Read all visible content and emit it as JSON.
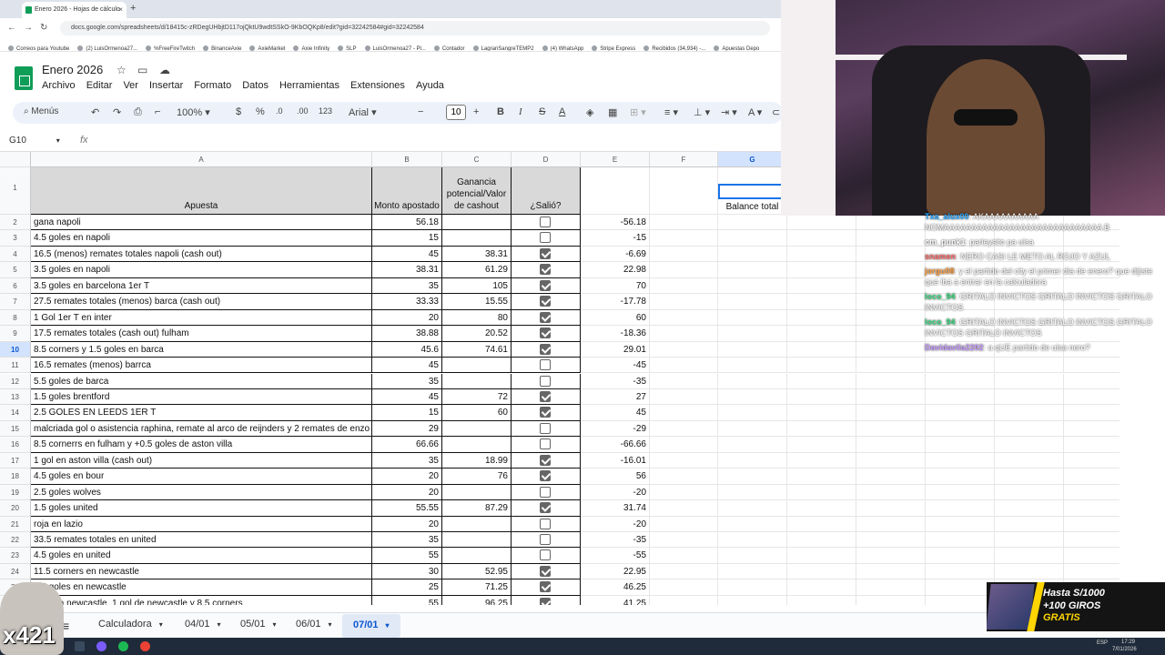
{
  "browser": {
    "tab_title": "Enero 2026 - Hojas de cálculo",
    "new_tab": "+",
    "url": "docs.google.com/spreadsheets/d/18415c-zRDegUHbjtD117ojQktU9wdtSSkO-9KbOQKp8/edit?gid=32242584#gid=32242584",
    "bookmarks": [
      "Correos para Youtube",
      "(2) LuisOrmenoa27...",
      "%FreeFireTwitch",
      "BinanceAxie",
      "AxieMarket",
      "Axie Infinity",
      "SLP",
      "LuisOrmenoa27 - Pl...",
      "Contador",
      "LagranSangreTEMP2",
      "(4) WhatsApp",
      "Stripe Express",
      "Recibidos (34,934) -...",
      "Apuestas Depo"
    ]
  },
  "sheets": {
    "doc_title": "Enero 2026",
    "menu": [
      "Archivo",
      "Editar",
      "Ver",
      "Insertar",
      "Formato",
      "Datos",
      "Herramientas",
      "Extensiones",
      "Ayuda"
    ],
    "toolbar": {
      "search": "Menús",
      "zoom": "100%",
      "currency": "$",
      "percent": "%",
      "dec_less": ".0",
      "dec_more": ".00",
      "format_123": "123",
      "font": "Arial",
      "font_size": "10",
      "bold": "B",
      "italic": "I"
    },
    "name_box": "G10",
    "fx": "fx",
    "col_headers": [
      "A",
      "B",
      "C",
      "D",
      "E",
      "F",
      "G"
    ],
    "headers": {
      "apuesta": "Apuesta",
      "monto": "Monto apostado",
      "ganancia": "Ganancia potencial/Valor de cashout",
      "salio": "¿Salió?",
      "balance": "Balance total"
    },
    "rows": [
      {
        "n": "2",
        "a": "gana napoli",
        "b": "56.18",
        "c": "",
        "d": false,
        "e": "-56.18"
      },
      {
        "n": "3",
        "a": "4.5 goles en napoli",
        "b": "15",
        "c": "",
        "d": false,
        "e": "-15"
      },
      {
        "n": "4",
        "a": "16.5 (menos) remates totales napoli (cash out)",
        "b": "45",
        "c": "38.31",
        "d": true,
        "e": "-6.69"
      },
      {
        "n": "5",
        "a": "3.5 goles en napoli",
        "b": "38.31",
        "c": "61.29",
        "d": true,
        "e": "22.98"
      },
      {
        "n": "6",
        "a": "3.5 goles en barcelona 1er T",
        "b": "35",
        "c": "105",
        "d": true,
        "e": "70"
      },
      {
        "n": "7",
        "a": "27.5 remates totales (menos) barca (cash out)",
        "b": "33.33",
        "c": "15.55",
        "d": true,
        "e": "-17.78"
      },
      {
        "n": "8",
        "a": "1 Gol 1er T en inter",
        "b": "20",
        "c": "80",
        "d": true,
        "e": "60"
      },
      {
        "n": "9",
        "a": "17.5 remates totales (cash out) fulham",
        "b": "38.88",
        "c": "20.52",
        "d": true,
        "e": "-18.36"
      },
      {
        "n": "10",
        "a": "8.5 corners y 1.5 goles en barca",
        "b": "45.6",
        "c": "74.61",
        "d": true,
        "e": "29.01"
      },
      {
        "n": "11",
        "a": "16.5 remates (menos) barrca",
        "b": "45",
        "c": "",
        "d": false,
        "e": "-45"
      },
      {
        "n": "12",
        "a": "5.5 goles de barca",
        "b": "35",
        "c": "",
        "d": false,
        "e": "-35"
      },
      {
        "n": "13",
        "a": "1.5 goles brentford",
        "b": "45",
        "c": "72",
        "d": true,
        "e": "27"
      },
      {
        "n": "14",
        "a": "2.5 GOLES EN LEEDS 1ER T",
        "b": "15",
        "c": "60",
        "d": true,
        "e": "45"
      },
      {
        "n": "15",
        "a": "malcriada gol o asistencia raphina, remate al arco de reijnders y 2 remates de enzo",
        "b": "29",
        "c": "",
        "d": false,
        "e": "-29"
      },
      {
        "n": "16",
        "a": "8.5 cornerrs en fulham y +0.5 goles de aston villa",
        "b": "66.66",
        "c": "",
        "d": false,
        "e": "-66.66"
      },
      {
        "n": "17",
        "a": "1 gol en aston villa (cash out)",
        "b": "35",
        "c": "18.99",
        "d": true,
        "e": "-16.01"
      },
      {
        "n": "18",
        "a": "4.5 goles en bour",
        "b": "20",
        "c": "76",
        "d": true,
        "e": "56"
      },
      {
        "n": "19",
        "a": "2.5 goles wolves",
        "b": "20",
        "c": "",
        "d": false,
        "e": "-20"
      },
      {
        "n": "20",
        "a": "1.5 goles united",
        "b": "55.55",
        "c": "87.29",
        "d": true,
        "e": "31.74"
      },
      {
        "n": "21",
        "a": "roja en lazio",
        "b": "20",
        "c": "",
        "d": false,
        "e": "-20"
      },
      {
        "n": "22",
        "a": "33.5 remates totales en united",
        "b": "35",
        "c": "",
        "d": false,
        "e": "-35"
      },
      {
        "n": "23",
        "a": "4.5 goles en united",
        "b": "55",
        "c": "",
        "d": false,
        "e": "-55"
      },
      {
        "n": "24",
        "a": "11.5 corners en newcastle",
        "b": "30",
        "c": "52.95",
        "d": true,
        "e": "22.95"
      },
      {
        "n": "25",
        "a": "6.5 goles en newcastle",
        "b": "25",
        "c": "71.25",
        "d": true,
        "e": "46.25"
      },
      {
        "n": "26",
        "a": "empata newcastle, 1 gol de newcastle y 8.5 corners",
        "b": "55",
        "c": "96.25",
        "d": true,
        "e": "41.25"
      }
    ],
    "sheet_tabs": [
      "Calculadora",
      "04/01",
      "05/01",
      "06/01",
      "07/01"
    ],
    "active_tab": "07/01",
    "add_sheet": "+",
    "all_sheets": "≡"
  },
  "stream": {
    "chat": [
      {
        "user": "Txa_alux00",
        "color": "#2aa7ff",
        "msg": ": AKAAAAAAAAAA NOMAAAAAAAAAAAAAAAAAAAAAAAAAAAAA B"
      },
      {
        "user": "cm_punk1",
        "color": "#ffffff",
        "msg": ": parleysito pa ulsa"
      },
      {
        "user": "snamen",
        "color": "#ff6b6b",
        "msg": ": NERO CASI LE METO AL ROJO Y AZUL"
      },
      {
        "user": "jorgu08",
        "color": "#ff9e3d",
        "msg": ": y el partido del city el primer dia de enero? que dijiste que iba a entrar en la calculadora"
      },
      {
        "user": "loco_94",
        "color": "#3ddc84",
        "msg": ": GRITALO INVICTOS GRITALO INVICTOS GRITALO INVICTOS"
      },
      {
        "user": "loco_94",
        "color": "#3ddc84",
        "msg": ": GRITALO INVICTOS GRITALO INVICTOS GRITALO INVICTOS GRITALO INVICTOS"
      },
      {
        "user": "Davidavila2202",
        "color": "#c89bff",
        "msg": ": a qUE partido de ulsa nero?"
      }
    ],
    "promo": {
      "line1": "Hasta S/1000",
      "line2": "+100 GIROS",
      "line3": "GRATIS"
    },
    "sticker_text": "x421"
  },
  "taskbar": {
    "lang": "ESP",
    "time": "17:29",
    "date": "7/01/2026"
  }
}
